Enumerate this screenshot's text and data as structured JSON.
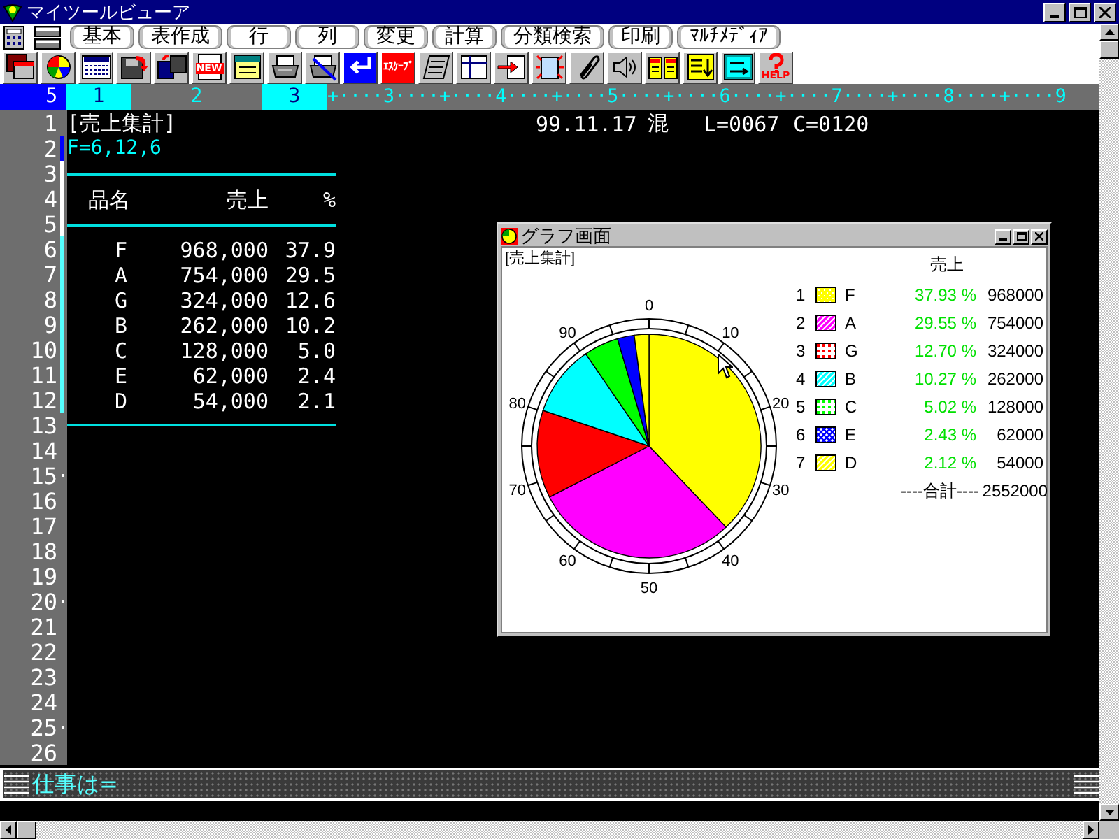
{
  "window": {
    "title": "マイツールビューア"
  },
  "menu": {
    "tabs": [
      {
        "label": "基本"
      },
      {
        "label": "表作成"
      },
      {
        "label": "行"
      },
      {
        "label": "列"
      },
      {
        "label": "変更"
      },
      {
        "label": "計算"
      },
      {
        "label": "分類検索"
      },
      {
        "label": "印刷"
      },
      {
        "label": "ﾏﾙﾁﾒﾃﾞｨｱ"
      }
    ]
  },
  "toolbar": [
    {
      "kind": "window"
    },
    {
      "kind": "pie"
    },
    {
      "kind": "card-grid"
    },
    {
      "kind": "disk-save"
    },
    {
      "kind": "disks"
    },
    {
      "kind": "new",
      "label": "NEW"
    },
    {
      "kind": "card"
    },
    {
      "kind": "printer"
    },
    {
      "kind": "printer-cancel"
    },
    {
      "kind": "enter"
    },
    {
      "kind": "escape",
      "label": "ｴｽｹｰﾌﾟ"
    },
    {
      "kind": "notebook"
    },
    {
      "kind": "table"
    },
    {
      "kind": "import"
    },
    {
      "kind": "sparkle"
    },
    {
      "kind": "clip"
    },
    {
      "kind": "speaker"
    },
    {
      "kind": "book"
    },
    {
      "kind": "list-down"
    },
    {
      "kind": "list-right"
    },
    {
      "kind": "help",
      "label": "HELP"
    }
  ],
  "ruler": {
    "cells": [
      {
        "label": "5",
        "kind": "line"
      },
      {
        "label": "1",
        "kind": "field",
        "selected": true
      },
      {
        "label": "2",
        "kind": "field",
        "selected": false
      },
      {
        "label": "3",
        "kind": "field",
        "selected": true
      }
    ],
    "scale": "+····3····+····4····+····5····+····6····+····7····+····8····+····9"
  },
  "editor": {
    "lines": [
      {
        "number": "1",
        "dot": false
      },
      {
        "number": "2",
        "dot": false,
        "color": "#0000ff"
      },
      {
        "number": "3",
        "dot": false,
        "color": "#ffffff"
      },
      {
        "number": "4",
        "dot": false,
        "color": "#ffffff"
      },
      {
        "number": "5",
        "dot": false,
        "color": "#ffffff"
      },
      {
        "number": "6",
        "dot": false,
        "color": "#55ffff"
      },
      {
        "number": "7",
        "dot": false,
        "color": "#55ffff"
      },
      {
        "number": "8",
        "dot": false,
        "color": "#55ffff"
      },
      {
        "number": "9",
        "dot": false,
        "color": "#55ffff"
      },
      {
        "number": "10",
        "dot": false,
        "color": "#55ffff"
      },
      {
        "number": "11",
        "dot": false,
        "color": "#55ffff"
      },
      {
        "number": "12",
        "dot": false,
        "color": "#55ffff"
      },
      {
        "number": "13",
        "dot": false
      },
      {
        "number": "14",
        "dot": false
      },
      {
        "number": "15",
        "dot": true
      },
      {
        "number": "16",
        "dot": false
      },
      {
        "number": "17",
        "dot": false
      },
      {
        "number": "18",
        "dot": false
      },
      {
        "number": "19",
        "dot": false
      },
      {
        "number": "20",
        "dot": true
      },
      {
        "number": "21",
        "dot": false
      },
      {
        "number": "22",
        "dot": false
      },
      {
        "number": "23",
        "dot": false
      },
      {
        "number": "24",
        "dot": false
      },
      {
        "number": "25",
        "dot": true
      },
      {
        "number": "26",
        "dot": false
      }
    ],
    "title": "[売上集計]",
    "date": "99.11.17",
    "mode": "混",
    "line_pos": "L=0067",
    "col_pos": "C=0120",
    "format": "F=6,12,6",
    "table": {
      "columns": [
        "品名",
        "売上",
        "%"
      ],
      "rows": [
        [
          "F",
          "968,000",
          "37.9"
        ],
        [
          "A",
          "754,000",
          "29.5"
        ],
        [
          "G",
          "324,000",
          "12.6"
        ],
        [
          "B",
          "262,000",
          "10.2"
        ],
        [
          "C",
          "128,000",
          "5.0"
        ],
        [
          "E",
          "62,000",
          "2.4"
        ],
        [
          "D",
          "54,000",
          "2.1"
        ]
      ]
    }
  },
  "graph": {
    "title": "グラフ画面",
    "chart_data": {
      "type": "pie",
      "title": "[売上集計]",
      "categories": [
        "F",
        "A",
        "G",
        "B",
        "C",
        "E",
        "D"
      ],
      "values": [
        37.93,
        29.55,
        12.7,
        10.27,
        5.02,
        2.43,
        2.12
      ]
    },
    "scale": [
      "0",
      "10",
      "20",
      "30",
      "40",
      "50",
      "60",
      "70",
      "80",
      "90"
    ],
    "legend_header": "売上",
    "legend": [
      {
        "number": "1",
        "percent": "37.93 %",
        "value": "968000",
        "color": "#ffff00",
        "kind": "dither"
      },
      {
        "number": "2",
        "percent": "29.55 %",
        "value": "754000",
        "color": "#ff00ff",
        "kind": "hatch"
      },
      {
        "number": "3",
        "percent": "12.70 %",
        "value": "324000",
        "color": "#ff0000",
        "kind": "dots"
      },
      {
        "number": "4",
        "percent": "10.27 %",
        "value": "262000",
        "color": "#00ffff",
        "kind": "hatch"
      },
      {
        "number": "5",
        "percent": "5.02 %",
        "value": "128000",
        "color": "#00ff00",
        "kind": "dots"
      },
      {
        "number": "6",
        "percent": "2.43 %",
        "value": "62000",
        "color": "#0000ff",
        "kind": "cross"
      },
      {
        "number": "7",
        "percent": "2.12 %",
        "value": "54000",
        "color": "#ffff00",
        "kind": "hatch"
      }
    ],
    "total_label": "----合計----",
    "total": "2552000"
  },
  "command": {
    "prompt": "仕事は="
  }
}
